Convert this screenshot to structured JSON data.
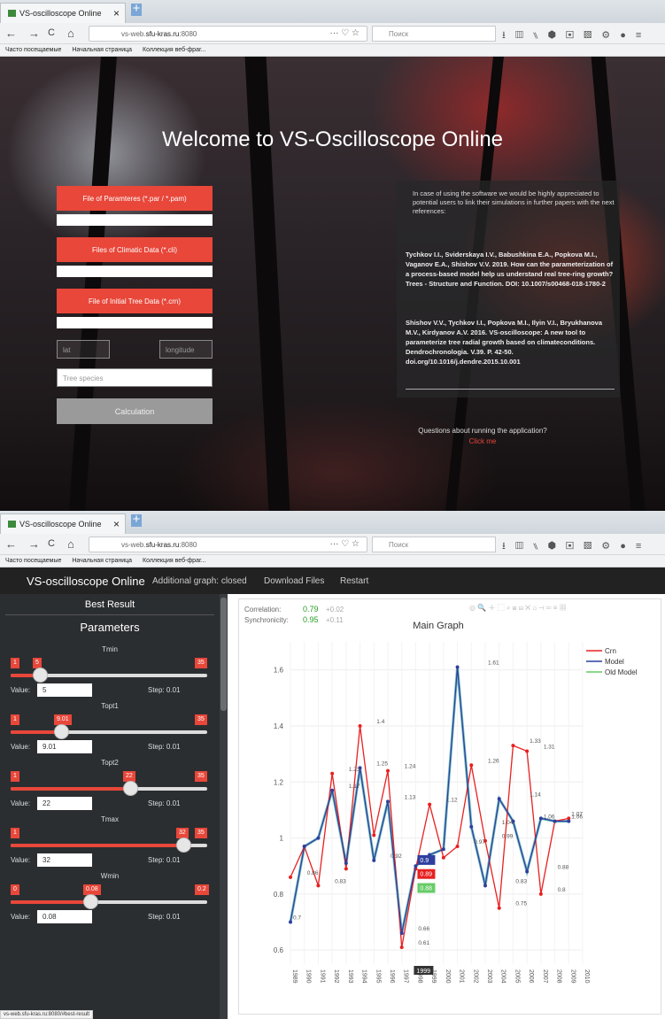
{
  "browser": {
    "tab_title": "VS-oscilloscope Online",
    "tab_close": "×",
    "new_tab": "+",
    "url_prefix": "vs-web.",
    "url_host": "sfu-kras.ru",
    "url_port": ":8080",
    "url_menu": "··· ♡ ☆",
    "search_placeholder": "Поиск",
    "bookmarks": [
      "Часто посещаемые",
      "Начальная страница",
      "Коллекция веб-фраг..."
    ],
    "back": "←",
    "forward": "→",
    "reload": "C",
    "home": "⌂",
    "toolbar_icons": "⭳ ▥ ⑊ ⬢ ▣ ▩ ⚙ ● ≡"
  },
  "landing": {
    "title": "Welcome to VS-Oscilloscope Online",
    "btn_params": "File of Paramteres (*.par / *.pam)",
    "btn_climate": "Files of Climatic Data (*.cli)",
    "btn_tree": "File of Initial Tree Data (*.crn)",
    "lat_placeholder": "lat",
    "lon_placeholder": "longitude",
    "species_placeholder": "Tree species",
    "calc_label": "Calculation",
    "info_text": "In case of using the software we would be highly appreciated to potential users to link their simulations in further papers with the next references:",
    "ref1": "Tychkov I.I., Sviderskaya I.V., Babushkina E.A., Popkova M.I., Vaganov E.A., Shishov V.V. 2019. How can the parameterization of a process-based model help us understand real tree-ring growth? Trees - Structure and Function. DOI: 10.1007/s00468-018-1780-2",
    "ref2": "Shishov V.V., Tychkov I.I., Popkova M.I., Ilyin V.I., Bryukhanova M.V., Kirdyanov A.V. 2016. VS-oscilloscope: A new tool to parameterize tree radial growth based on climateconditions. Dendrochronologia. V.39. P. 42-50. doi.org/10.1016/j.dendre.2015.10.001",
    "question": "Questions about running the application?",
    "click_me": "Click me"
  },
  "app": {
    "brand": "VS-oscilloscope Online",
    "nav": [
      "Additional graph: closed",
      "Download Files",
      "Restart"
    ],
    "best_result": "Best Result",
    "parameters": "Parameters",
    "value_label": "Value:",
    "params": [
      {
        "name": "Tmin",
        "min": "1",
        "max": "35",
        "value": "5",
        "step": "Step: 0.01",
        "fraction": 0.12
      },
      {
        "name": "Topt1",
        "min": "1",
        "max": "35",
        "value": "9.01",
        "step": "Step: 0.01",
        "fraction": 0.24
      },
      {
        "name": "Topt2",
        "min": "1",
        "max": "35",
        "value": "22",
        "step": "Step: 0.01",
        "fraction": 0.62
      },
      {
        "name": "Tmax",
        "min": "1",
        "max": "35",
        "value": "32",
        "step": "Step: 0.01",
        "fraction": 0.91
      },
      {
        "name": "Wmin",
        "min": "0",
        "max": "0.2",
        "value": "0.08",
        "step": "Step: 0.01",
        "fraction": 0.4
      }
    ],
    "status_url": "vs-web.sfu-kras.ru:8080/#best-result",
    "correlation_label": "Correlation:",
    "correlation_value": "0.79",
    "correlation_delta": "+0.02",
    "synchronicity_label": "Synchronicity:",
    "synchronicity_value": "0.95",
    "synchronicity_delta": "+0.11",
    "plot_toolbar": "◎ 🔍 ＋ ⬚ ⌕ ⊞ ⊟ ✕ ⌂ ⊣ ═ ≡ ▦",
    "hover_year": "1999",
    "hover_model": "0.9",
    "hover_crn": "0.89",
    "hover_old": "0.88"
  },
  "colors": {
    "accent_red": "#e8473a",
    "model_blue": "#2f3f9f",
    "old_green": "#66cc66",
    "crn_red": "#e82020",
    "teal": "#3aa6a6"
  },
  "chart_data": {
    "type": "line",
    "title": "Main Graph",
    "x": [
      1989,
      1990,
      1991,
      1992,
      1993,
      1994,
      1995,
      1996,
      1997,
      1998,
      1999,
      2000,
      2001,
      2002,
      2003,
      2004,
      2005,
      2006,
      2007,
      2008,
      2009,
      2010
    ],
    "ylim": [
      0.55,
      1.7
    ],
    "yticks": [
      0.6,
      0.8,
      1,
      1.2,
      1.4,
      1.6
    ],
    "legend_position": "top-right",
    "series": [
      {
        "name": "Crn",
        "color": "#e82020",
        "x": [
          1989,
          1990,
          1991,
          1992,
          1993,
          1994,
          1995,
          1996,
          1997,
          1998,
          1999,
          2000,
          2001,
          2002,
          2003,
          2004,
          2005,
          2006,
          2007,
          2008,
          2009
        ],
        "values": [
          0.86,
          0.97,
          0.83,
          1.23,
          0.89,
          1.4,
          1.01,
          1.24,
          0.61,
          0.89,
          1.12,
          0.93,
          0.97,
          1.26,
          0.99,
          0.75,
          1.33,
          1.31,
          0.8,
          1.06,
          1.07
        ]
      },
      {
        "name": "Model",
        "color": "#2f3f9f",
        "x": [
          1989,
          1990,
          1991,
          1992,
          1993,
          1994,
          1995,
          1996,
          1997,
          1998,
          1999,
          2000,
          2001,
          2002,
          2003,
          2004,
          2005,
          2006,
          2007,
          2008,
          2009
        ],
        "values": [
          0.7,
          0.97,
          1.0,
          1.17,
          0.91,
          1.25,
          0.92,
          1.13,
          0.66,
          0.9,
          0.94,
          0.96,
          1.61,
          1.04,
          0.83,
          1.14,
          1.06,
          0.88,
          1.07,
          1.06,
          1.06
        ]
      }
    ],
    "data_labels": [
      {
        "x": 1990,
        "y": 0.86,
        "text": "0.86"
      },
      {
        "x": 1989,
        "y": 0.7,
        "text": "0.7"
      },
      {
        "x": 1992,
        "y": 0.83,
        "text": "0.83"
      },
      {
        "x": 1993,
        "y": 1.23,
        "text": "1.23"
      },
      {
        "x": 1993,
        "y": 1.17,
        "text": "1.17"
      },
      {
        "x": 1995,
        "y": 1.4,
        "text": "1.4"
      },
      {
        "x": 1995,
        "y": 1.25,
        "text": "1.25"
      },
      {
        "x": 1997,
        "y": 1.24,
        "text": "1.24"
      },
      {
        "x": 1997,
        "y": 1.13,
        "text": "1.13"
      },
      {
        "x": 1996,
        "y": 0.92,
        "text": "0.92"
      },
      {
        "x": 1998,
        "y": 0.66,
        "text": "0.66"
      },
      {
        "x": 1998,
        "y": 0.61,
        "text": "0.61"
      },
      {
        "x": 2000,
        "y": 1.12,
        "text": "1.12"
      },
      {
        "x": 2002,
        "y": 0.97,
        "text": "0.97"
      },
      {
        "x": 2003,
        "y": 1.61,
        "text": "1.61"
      },
      {
        "x": 2003,
        "y": 1.26,
        "text": "1.26"
      },
      {
        "x": 2004,
        "y": 1.04,
        "text": "1.04"
      },
      {
        "x": 2004,
        "y": 0.99,
        "text": "0.99"
      },
      {
        "x": 2006,
        "y": 1.33,
        "text": "1.33"
      },
      {
        "x": 2007,
        "y": 1.31,
        "text": "1.31"
      },
      {
        "x": 2006,
        "y": 1.14,
        "text": "1.14"
      },
      {
        "x": 2007,
        "y": 1.06,
        "text": "1.06"
      },
      {
        "x": 2005,
        "y": 0.83,
        "text": "0.83"
      },
      {
        "x": 2005,
        "y": 0.75,
        "text": "0.75"
      },
      {
        "x": 2008,
        "y": 0.88,
        "text": "0.88"
      },
      {
        "x": 2008,
        "y": 0.8,
        "text": "0.8"
      },
      {
        "x": 2009,
        "y": 1.07,
        "text": "1.07"
      },
      {
        "x": 2009,
        "y": 1.06,
        "text": "1.06"
      }
    ],
    "legend": [
      "Crn",
      "Model",
      "Old Model"
    ]
  }
}
